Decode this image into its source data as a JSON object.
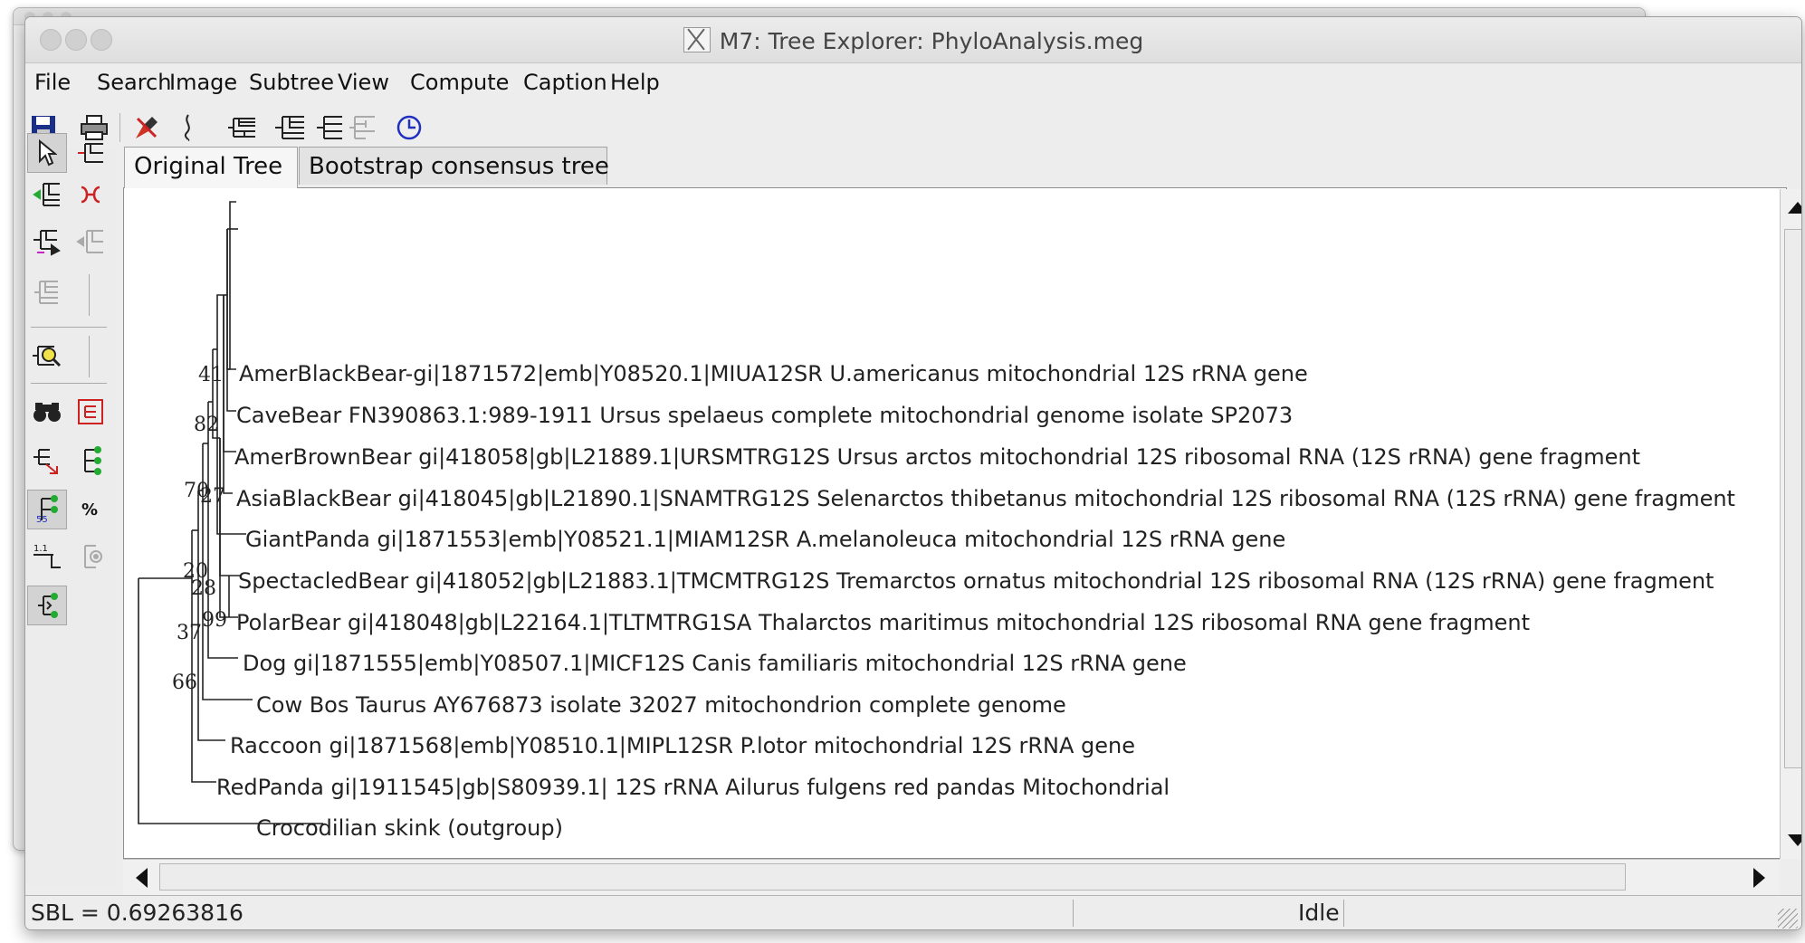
{
  "window": {
    "title": "M7: Tree Explorer: PhyloAnalysis.meg"
  },
  "menu": [
    "File",
    "Search",
    "Image",
    "Subtree",
    "View",
    "Compute",
    "Caption",
    "Help"
  ],
  "toolbar": {
    "icons": [
      "save-icon",
      "print-icon",
      "brush-icon",
      "ruler-icon",
      "rectangular-tree-icon",
      "slanted-tree-icon",
      "straight-tree-icon",
      "radiation-tree-icon",
      "circle-tree-icon"
    ]
  },
  "left_tools": {
    "icons": [
      "pointer-icon",
      "root-tree-icon",
      "swap-branch-icon",
      "flip-subtree-icon",
      "compress-subtree-icon",
      "expand-subtree-icon",
      "subtree-disabled-icon",
      "search-taxa-icon",
      "find-icon",
      "fit-window-icon",
      "group-taxa-icon",
      "branch-length-icon",
      "bootstrap-icon",
      "percent-icon",
      "scale-icon",
      "gear-tree-icon",
      "topology-icon"
    ]
  },
  "tabs": [
    {
      "label": "Original Tree",
      "active": true
    },
    {
      "label": "Bootstrap consensus tree",
      "active": false
    }
  ],
  "tree": {
    "leaves": [
      "AmerBlackBear-gi|1871572|emb|Y08520.1|MIUA12SR U.americanus mitochondrial 12S rRNA gene",
      "CaveBear FN390863.1:989-1911 Ursus spelaeus complete mitochondrial genome isolate SP2073",
      "AmerBrownBear gi|418058|gb|L21889.1|URSMTRG12S Ursus arctos mitochondrial 12S ribosomal RNA (12S rRNA) gene fragment",
      "AsiaBlackBear gi|418045|gb|L21890.1|SNAMTRG12S Selenarctos thibetanus mitochondrial 12S ribosomal RNA (12S rRNA) gene fragment",
      "GiantPanda gi|1871553|emb|Y08521.1|MIAM12SR A.melanoleuca mitochondrial 12S rRNA gene",
      "SpectacledBear gi|418052|gb|L21883.1|TMCMTRG12S Tremarctos ornatus mitochondrial 12S ribosomal RNA (12S rRNA) gene fragment",
      "PolarBear gi|418048|gb|L22164.1|TLTMTRG1SA Thalarctos maritimus mitochondrial 12S ribosomal RNA gene fragment",
      "Dog gi|1871555|emb|Y08507.1|MICF12S Canis familiaris mitochondrial 12S rRNA gene",
      "Cow Bos Taurus AY676873 isolate 32027 mitochondrion complete genome",
      "Raccoon gi|1871568|emb|Y08510.1|MIPL12SR P.lotor mitochondrial 12S rRNA gene",
      "RedPanda gi|1911545|gb|S80939.1| 12S rRNA Ailurus fulgens red pandas Mitochondrial",
      "Crocodilian skink (outgroup)"
    ],
    "supports": [
      "41",
      "82",
      "70",
      "27",
      "20",
      "28",
      "99",
      "37",
      "66"
    ]
  },
  "status": {
    "sbl": "SBL = 0.69263816",
    "state": "Idle"
  }
}
